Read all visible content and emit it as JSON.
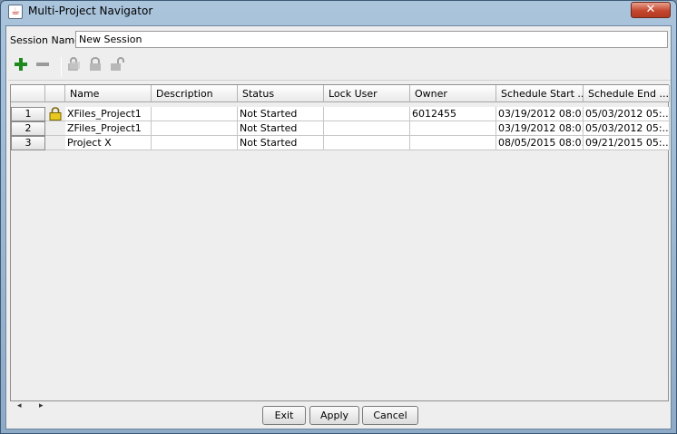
{
  "window": {
    "title": "Multi-Project Navigator",
    "close_glyph": "✕"
  },
  "session": {
    "label": "Session Name:",
    "value": "New Session"
  },
  "toolbar": {
    "items": [
      {
        "icon": "add-icon",
        "glyph": "+",
        "color": "#1e8a1e"
      },
      {
        "icon": "remove-icon",
        "glyph": "—",
        "color": "#9a9a9a"
      },
      {
        "icon": "lock-all-icon"
      },
      {
        "icon": "lock-icon"
      },
      {
        "icon": "unlock-icon"
      }
    ]
  },
  "table": {
    "columns": [
      "Name",
      "Description",
      "Status",
      "Lock User",
      "Owner",
      "Schedule Start ...",
      "Schedule End ..."
    ],
    "rows": [
      {
        "num": "1",
        "locked": true,
        "cells": [
          "XFiles_Project1",
          "",
          "Not Started",
          "",
          "6012455",
          "03/19/2012 08:0...",
          "05/03/2012 05:..."
        ]
      },
      {
        "num": "2",
        "locked": false,
        "cells": [
          "ZFiles_Project1",
          "",
          "Not Started",
          "",
          "",
          "03/19/2012 08:0...",
          "05/03/2012 05:..."
        ]
      },
      {
        "num": "3",
        "locked": false,
        "cells": [
          "Project X",
          "",
          "Not Started",
          "",
          "",
          "08/05/2015 08:0...",
          "09/21/2015 05:..."
        ]
      }
    ]
  },
  "buttons": {
    "exit": "Exit",
    "apply": "Apply",
    "cancel": "Cancel"
  },
  "scroll": {
    "left": "◂",
    "right": "▸"
  }
}
